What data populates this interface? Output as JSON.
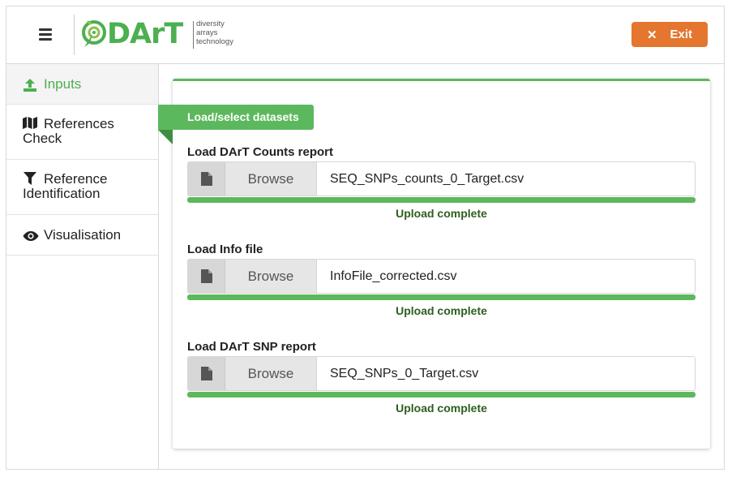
{
  "header": {
    "logo_word": "DArT",
    "logo_tagline": [
      "diversity",
      "arrays",
      "technology"
    ],
    "exit_label": "Exit"
  },
  "sidebar": {
    "items": [
      {
        "label": "Inputs",
        "icon": "upload-icon",
        "active": true
      },
      {
        "label": "References Check",
        "icon": "map-icon",
        "active": false
      },
      {
        "label": "Reference Identification",
        "icon": "filter-icon",
        "active": false
      },
      {
        "label": "Visualisation",
        "icon": "eye-icon",
        "active": false
      }
    ]
  },
  "main": {
    "ribbon_title": "Load/select datasets",
    "sections": [
      {
        "label": "Load DArT Counts report",
        "browse_label": "Browse",
        "file_name": "SEQ_SNPs_counts_0_Target.csv",
        "progress": 1.0,
        "status": "Upload complete"
      },
      {
        "label": "Load Info file",
        "browse_label": "Browse",
        "file_name": "InfoFile_corrected.csv",
        "progress": 1.0,
        "status": "Upload complete"
      },
      {
        "label": "Load DArT SNP report",
        "browse_label": "Browse",
        "file_name": "SEQ_SNPs_0_Target.csv",
        "progress": 1.0,
        "status": "Upload complete"
      }
    ]
  },
  "colors": {
    "accent_green": "#5cb85c",
    "exit_orange": "#e4762f",
    "status_text": "#2e5e1f"
  }
}
